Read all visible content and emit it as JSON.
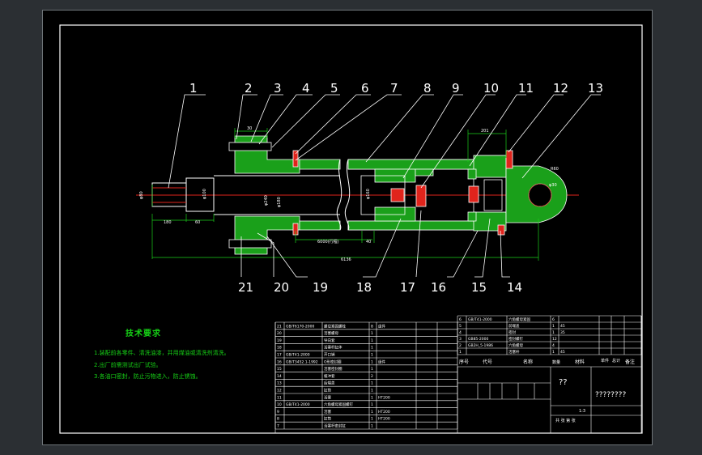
{
  "balloons": [
    "1",
    "2",
    "3",
    "4",
    "5",
    "6",
    "7",
    "8",
    "9",
    "10",
    "11",
    "12",
    "13",
    "21",
    "20",
    "19",
    "18",
    "17",
    "16",
    "15",
    "14"
  ],
  "dims": {
    "d180": "180",
    "d60": "60",
    "d6136": "6136",
    "d6000": "6000(行程)",
    "d40": "40",
    "d30": "30",
    "d201": "201",
    "r60": "R60",
    "phi30": "φ30",
    "dia_rod": "φ80",
    "dia_end": "φ100",
    "dia_bore1": "φ240",
    "dia_bore2": "φ180",
    "dia_piston": "φ160"
  },
  "tech": {
    "title": "技术要求",
    "lines": [
      "1.装配前各零件、清洗油漆，并用煤油或清洗剂清洗。",
      "2.出厂前需测试出厂试验。",
      "3.各油口密封，防止污物进入，防止锈蚀。"
    ]
  },
  "bom_left": [
    {
      "no": "21",
      "code": "GB/T6170-2000",
      "name": "螺母紧固螺栓",
      "qty": "8",
      "mat": "组件"
    },
    {
      "no": "20",
      "code": "",
      "name": "活塞螺母",
      "qty": "1",
      "mat": ""
    },
    {
      "no": "19",
      "code": "",
      "name": "导向套",
      "qty": "1",
      "mat": ""
    },
    {
      "no": "18",
      "code": "",
      "name": "活塞杆缸体",
      "qty": "1",
      "mat": ""
    },
    {
      "no": "17",
      "code": "GB/T41-2000",
      "name": "开口销",
      "qty": "1",
      "mat": ""
    },
    {
      "no": "16",
      "code": "GB/T3452.1-1992",
      "name": "O形密封圈",
      "qty": "1",
      "mat": "组件"
    },
    {
      "no": "15",
      "code": "",
      "name": "活塞密封圈",
      "qty": "1",
      "mat": ""
    },
    {
      "no": "14",
      "code": "",
      "name": "缓冲套",
      "qty": "2",
      "mat": ""
    },
    {
      "no": "13",
      "code": "",
      "name": "后端盖",
      "qty": "1",
      "mat": ""
    },
    {
      "no": "12",
      "code": "",
      "name": "缸筒",
      "qty": "1",
      "mat": ""
    },
    {
      "no": "11",
      "code": "",
      "name": "活塞",
      "qty": "1",
      "mat": "HT200"
    },
    {
      "no": "10",
      "code": "GB/T41-2000",
      "name": "六角螺母紧固螺钉",
      "qty": "1",
      "mat": ""
    },
    {
      "no": "9",
      "code": "",
      "name": "活塞",
      "qty": "1",
      "mat": "HT200"
    },
    {
      "no": "8",
      "code": "",
      "name": "缸筒",
      "qty": "1",
      "mat": "HT200"
    },
    {
      "no": "7",
      "code": "",
      "name": "活塞杆密封缸",
      "qty": "1",
      "mat": ""
    }
  ],
  "bom_right": [
    {
      "no": "6",
      "code": "GB/T41-2000",
      "name": "六角螺母紧固",
      "qty": "6",
      "mat": ""
    },
    {
      "no": "5",
      "code": "",
      "name": "前端盖",
      "qty": "1",
      "mat": "45"
    },
    {
      "no": "4",
      "code": "",
      "name": "密封",
      "qty": "1",
      "mat": "35"
    },
    {
      "no": "3",
      "code": "GB85-2000",
      "name": "密封螺钉",
      "qty": "12",
      "mat": ""
    },
    {
      "no": "2",
      "code": "GB2H_5-1986",
      "name": "六角螺母",
      "qty": "4",
      "mat": ""
    },
    {
      "no": "1",
      "code": "",
      "name": "活塞杆",
      "qty": "1",
      "mat": "45"
    }
  ],
  "bom_header": {
    "no": "序号",
    "code": "代号",
    "name": "名称",
    "qty": "数量",
    "mat": "材料",
    "unit": "单件",
    "total": "总计",
    "weight": "重量",
    "note": "备注"
  },
  "title_block": {
    "drawing": "??",
    "name": "????????",
    "scale": "1:3",
    "sheet": "共 张 第 张"
  }
}
